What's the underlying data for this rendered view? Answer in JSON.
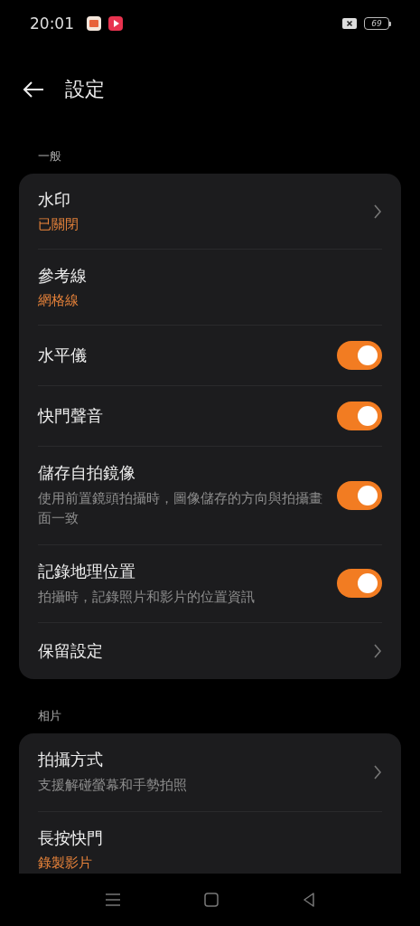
{
  "status_bar": {
    "time": "20:01",
    "battery": "69"
  },
  "header": {
    "title": "設定"
  },
  "sections": [
    {
      "label": "一般",
      "items": [
        {
          "kind": "nav",
          "title": "水印",
          "value": "已關閉"
        },
        {
          "kind": "plain",
          "title": "參考線",
          "value": "網格線"
        },
        {
          "kind": "toggle",
          "title": "水平儀",
          "on": true
        },
        {
          "kind": "toggle",
          "title": "快門聲音",
          "on": true
        },
        {
          "kind": "toggle",
          "title": "儲存自拍鏡像",
          "subtitle": "使用前置鏡頭拍攝時，圖像儲存的方向與拍攝畫面一致",
          "on": true
        },
        {
          "kind": "toggle",
          "title": "記錄地理位置",
          "subtitle": "拍攝時，記錄照片和影片的位置資訊",
          "on": true
        },
        {
          "kind": "nav",
          "title": "保留設定"
        }
      ]
    },
    {
      "label": "相片",
      "items": [
        {
          "kind": "nav",
          "title": "拍攝方式",
          "subtitle": "支援解碰螢幕和手勢拍照"
        },
        {
          "kind": "plain",
          "title": "長按快門",
          "value": "錄製影片"
        }
      ]
    }
  ]
}
